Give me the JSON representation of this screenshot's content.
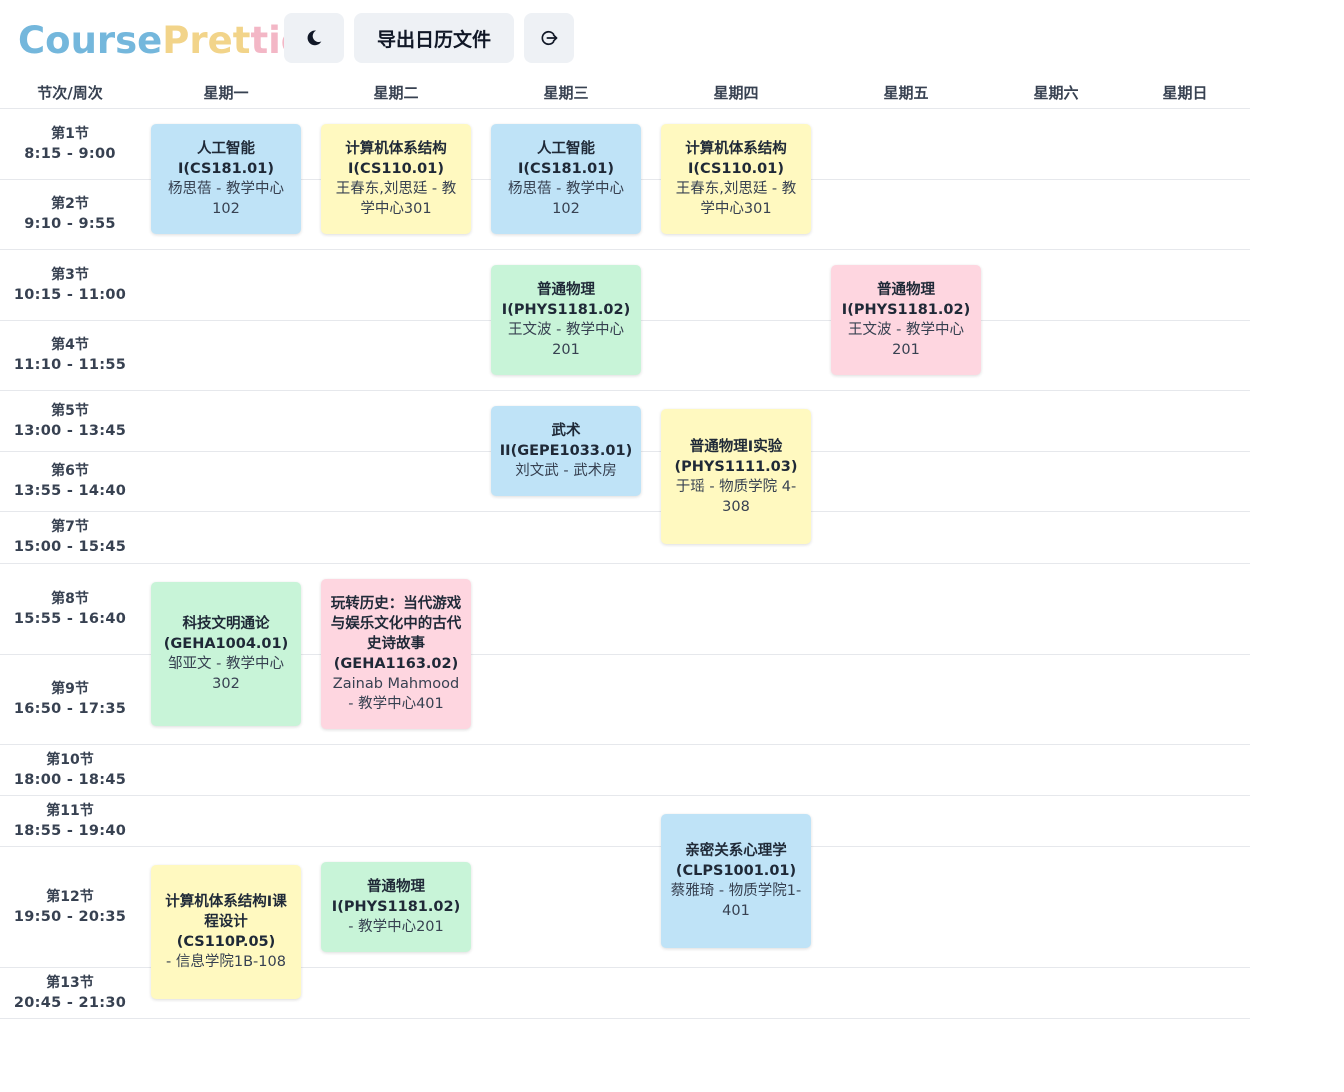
{
  "app": {
    "logo_parts": [
      "Course",
      "Pret",
      "tier"
    ],
    "theme_icon": "moon-icon",
    "export_label": "导出日历文件",
    "logout_icon": "logout-icon"
  },
  "colors": {
    "blue": "#bfe3f7",
    "yellow": "#fff9c0",
    "green": "#c8f4d8",
    "pink": "#fed6e0",
    "logo_blue": "#74b7dc",
    "logo_yellow": "#f2d48a",
    "logo_pink": "#f3b7c6"
  },
  "table": {
    "corner_header": "节次/周次",
    "days": [
      "星期一",
      "星期二",
      "星期三",
      "星期四",
      "星期五",
      "星期六",
      "星期日"
    ],
    "periods": [
      {
        "name": "第1节",
        "time": "8:15 - 9:00"
      },
      {
        "name": "第2节",
        "time": "9:10 - 9:55"
      },
      {
        "name": "第3节",
        "time": "10:15 - 11:00"
      },
      {
        "name": "第4节",
        "time": "11:10 - 11:55"
      },
      {
        "name": "第5节",
        "time": "13:00 - 13:45"
      },
      {
        "name": "第6节",
        "time": "13:55 - 14:40"
      },
      {
        "name": "第7节",
        "time": "15:00 - 15:45"
      },
      {
        "name": "第8节",
        "time": "15:55 - 16:40"
      },
      {
        "name": "第9节",
        "time": "16:50 - 17:35"
      },
      {
        "name": "第10节",
        "time": "18:00 - 18:45"
      },
      {
        "name": "第11节",
        "time": "18:55 - 19:40"
      },
      {
        "name": "第12节",
        "time": "19:50 - 20:35"
      },
      {
        "name": "第13节",
        "time": "20:45 - 21:30"
      }
    ]
  },
  "courses": [
    {
      "day": "星期一",
      "periods": "第1节-第2节",
      "color": "blue",
      "name": "人工智能I(CS181.01)",
      "info": "杨思蓓 - 教学中心102"
    },
    {
      "day": "星期二",
      "periods": "第1节-第2节",
      "color": "yellow",
      "name": "计算机体系结构I(CS110.01)",
      "info": "王春东,刘思廷 - 教学中心301"
    },
    {
      "day": "星期三",
      "periods": "第1节-第2节",
      "color": "blue",
      "name": "人工智能I(CS181.01)",
      "info": "杨思蓓 - 教学中心102"
    },
    {
      "day": "星期四",
      "periods": "第1节-第2节",
      "color": "yellow",
      "name": "计算机体系结构I(CS110.01)",
      "info": "王春东,刘思廷 - 教学中心301"
    },
    {
      "day": "星期三",
      "periods": "第3节-第4节",
      "color": "green",
      "name": "普通物理I(PHYS1181.02)",
      "info": "王文波 - 教学中心201"
    },
    {
      "day": "星期五",
      "periods": "第3节-第4节",
      "color": "pink",
      "name": "普通物理I(PHYS1181.02)",
      "info": "王文波 - 教学中心201"
    },
    {
      "day": "星期三",
      "periods": "第5节-第6节",
      "color": "blue",
      "name": "武术II(GEPE1033.01)",
      "info": "刘文武 - 武术房"
    },
    {
      "day": "星期四",
      "periods": "第5节-第7节",
      "color": "yellow",
      "name": "普通物理I实验(PHYS1111.03)",
      "info": "于瑶 - 物质学院 4-308"
    },
    {
      "day": "星期一",
      "periods": "第8节-第9节",
      "color": "green",
      "name": "科技文明通论(GEHA1004.01)",
      "info": "邹亚文 - 教学中心302"
    },
    {
      "day": "星期二",
      "periods": "第8节-第9节",
      "color": "pink",
      "name": "玩转历史：当代游戏与娱乐文化中的古代史诗故事(GEHA1163.02)",
      "info": "Zainab Mahmood - 教学中心401"
    },
    {
      "day": "星期四",
      "periods": "第11节-第12节",
      "color": "blue",
      "name": "亲密关系心理学(CLPS1001.01)",
      "info": "蔡雅琦 - 物质学院1-401"
    },
    {
      "day": "星期一",
      "periods": "第12节-第13节",
      "color": "yellow",
      "name": "计算机体系结构I课程设计(CS110P.05)",
      "info": " - 信息学院1B-108"
    },
    {
      "day": "星期二",
      "periods": "第12节",
      "color": "green",
      "name": "普通物理I(PHYS1181.02)",
      "info": " - 教学中心201"
    }
  ]
}
